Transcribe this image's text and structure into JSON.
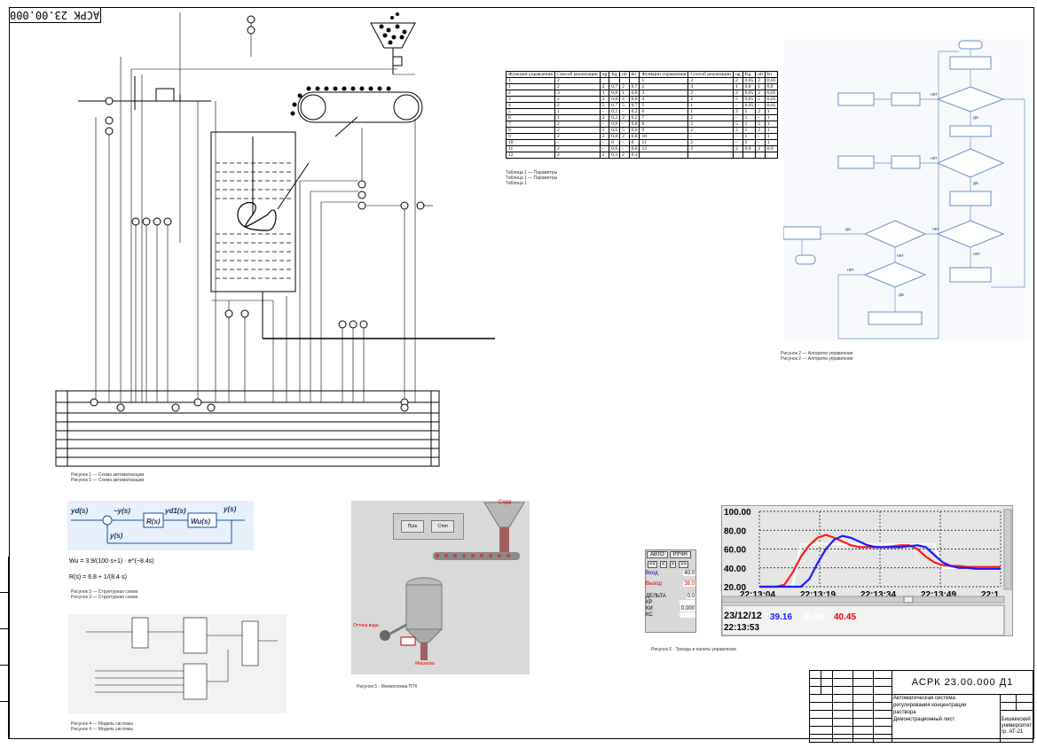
{
  "document": {
    "code_top": "АСРК 23.00.000",
    "title_block": {
      "designation": "АСРК 23.00.000 Д1",
      "name_lines": [
        "Автоматическая система",
        "регулирования концентрации",
        "раствора",
        "Демонстрационный лист"
      ],
      "org_lines": [
        "Бишкекский",
        "университет",
        "гр. АТ-21"
      ]
    }
  },
  "mimic": {
    "button_start": "Пуск",
    "button_stop": "Стоп",
    "label_soda": "Сода",
    "label_water": "Оттока вода",
    "label_output": "Мешалка",
    "caption": "Рисунок 5 - Мнемосхема ПТК"
  },
  "trend": {
    "yticks": [
      "100.00",
      "80.00",
      "60.00",
      "40.00",
      "20.00"
    ],
    "xticks": [
      "22:13:04",
      "22:13:19",
      "22:13:34",
      "22:13:49",
      "22:1"
    ],
    "date": "23/12/12",
    "time": "22:13:53",
    "val_blue": "39.16",
    "val_white": "40.00",
    "val_red": "40.45",
    "chart_data": {
      "type": "line",
      "x": [
        0,
        2,
        4,
        6,
        8,
        10,
        12,
        14,
        16,
        18,
        20,
        22,
        24,
        26,
        28,
        30,
        32,
        34,
        36,
        38,
        40,
        42,
        44,
        46,
        48,
        50,
        52,
        54,
        56,
        58
      ],
      "series": [
        {
          "color": "#ffffff",
          "values": [
            20,
            20,
            20,
            20,
            20,
            65,
            65,
            65,
            65,
            65,
            65,
            65,
            65,
            65,
            65,
            65,
            65,
            65,
            65,
            65,
            65,
            65,
            40,
            40,
            40,
            40,
            40,
            40,
            40,
            40
          ]
        },
        {
          "color": "#ff1a1a",
          "values": [
            20,
            20,
            20,
            22,
            35,
            52,
            64,
            72,
            75,
            72,
            68,
            64,
            62,
            62,
            62,
            62,
            63,
            64,
            64,
            60,
            52,
            46,
            43,
            42,
            42,
            41,
            41,
            41,
            41,
            41
          ]
        },
        {
          "color": "#1a1aff",
          "values": [
            20,
            20,
            20,
            20,
            20,
            20,
            28,
            45,
            60,
            70,
            74,
            72,
            68,
            64,
            62,
            62,
            62,
            62,
            63,
            64,
            62,
            54,
            46,
            42,
            40,
            40,
            39,
            39,
            39,
            39
          ]
        }
      ],
      "ylim": [
        20,
        100
      ]
    }
  },
  "control_panel": {
    "mode_auto": "АВТО",
    "mode_manual": "РУЧН",
    "label_in": "Вход",
    "label_out": "Выход",
    "val_in": "40.0",
    "val_out": "38.0",
    "label_delta": "ДЕЛЬТА",
    "val_delta": "0.0",
    "params": [
      "КР",
      "КИ",
      "КС"
    ],
    "param_vals": [
      "",
      "0.000",
      ""
    ],
    "caption": "Рисунок 6 - Тренды и панель управления"
  },
  "block_diagram": {
    "in_label": "yd(s)",
    "err_label": "~y(s)",
    "r_label": "R(s)",
    "mid_label": "yd1(s)",
    "plant_label": "Wu(s)",
    "out_label": "y(s)",
    "fb_label": "y(s)",
    "formula_w": "Wu = 3.9/(100·s+1) · e^(−8.4s)",
    "formula_r": "R(s) = 6.8 + 1/(8.4·s)"
  },
  "table": {
    "headers": [
      "Функции управления",
      "Способ реализации",
      "ug",
      "Kg",
      "n0",
      "Ki"
    ],
    "rows_left": [
      [
        "1",
        "2",
        "",
        "",
        "",
        ""
      ],
      [
        "1",
        "2",
        "2",
        "0,7",
        "2",
        "0,7"
      ],
      [
        "2",
        "3",
        "1",
        "0,8",
        "1",
        "0,8"
      ],
      [
        "3",
        "2",
        "2",
        "0,6",
        "2",
        "0,6"
      ],
      [
        "4",
        "2",
        "5",
        "0,7",
        "5",
        "0,7"
      ],
      [
        "5",
        "1",
        "-",
        "0,2",
        "-",
        "0,2"
      ],
      [
        "6",
        "1",
        "2",
        "0,2",
        "2",
        "0,2"
      ],
      [
        "7",
        "2",
        "-",
        "0,8",
        "-",
        "0,8"
      ],
      [
        "8",
        "2",
        "5",
        "0,6",
        "5",
        "0,6"
      ],
      [
        "9",
        "2",
        "2",
        "0,8",
        "2",
        "0,8"
      ],
      [
        "10",
        "-",
        "-",
        "0",
        "-",
        "0"
      ],
      [
        "11",
        "2",
        "-",
        "0,6",
        "-",
        "0,6"
      ],
      [
        "12",
        "2",
        "2",
        "0,3",
        "2",
        "0,3"
      ]
    ],
    "rows_right": [
      [
        "1",
        "2",
        "2",
        "0,05",
        "2",
        "0,05"
      ],
      [
        "2",
        "3",
        "1",
        "0,8",
        "1",
        "0,8"
      ],
      [
        "3",
        "2",
        "2",
        "0,05",
        "2",
        "0,05"
      ],
      [
        "4",
        "2",
        "5",
        "0,05",
        "5",
        "0,05"
      ],
      [
        "5",
        "1",
        "-",
        "0,05",
        "-",
        "0,05"
      ],
      [
        "6",
        "1",
        "2",
        "1",
        "2",
        "1"
      ],
      [
        "7",
        "2",
        "-",
        "1",
        "-",
        "1"
      ],
      [
        "8",
        "2",
        "5",
        "1",
        "5",
        "1"
      ],
      [
        "9",
        "2",
        "2",
        "1",
        "2",
        "1"
      ],
      [
        "10",
        "-",
        "-",
        "1",
        "-",
        "1"
      ],
      [
        "11",
        "2",
        "-",
        "1",
        "-",
        "1"
      ],
      [
        "12",
        "2",
        "2",
        "0,9",
        "2",
        "0,9"
      ]
    ]
  },
  "flowchart": {
    "yes": "да",
    "no": "нет"
  }
}
